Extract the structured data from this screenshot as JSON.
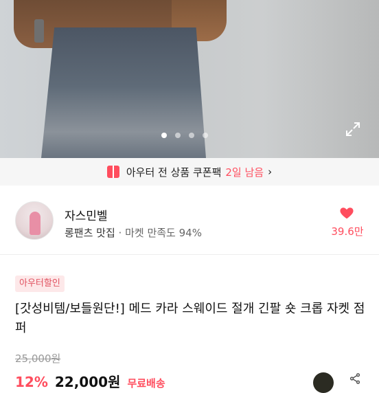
{
  "gallery": {
    "dots": [
      true,
      false,
      false,
      false
    ]
  },
  "banner": {
    "text": "아우터 전 상품 쿠폰팩",
    "days_left": "2일 남음",
    "chevron": "›"
  },
  "seller": {
    "name": "자스민벨",
    "tagline": "롱팬츠 맛집",
    "separator": " · ",
    "satisfaction": "마켓 만족도 94%",
    "likes": "39.6만"
  },
  "product": {
    "tag": "아우터할인",
    "title": "[갓성비템/보들원단!] 메드 카라 스웨이드 절개 긴팔 숏 크롭 자켓 점퍼",
    "original_price": "25,000원",
    "discount": "12%",
    "price": "22,000원",
    "shipping": "무료배송"
  },
  "colors": {
    "accent": "#ff4d5e",
    "banner_bg": "#f6f6f6",
    "tag_bg": "#fde8e9"
  },
  "icons": [
    "expand-icon",
    "gift-icon",
    "heart-icon",
    "share-icon"
  ]
}
